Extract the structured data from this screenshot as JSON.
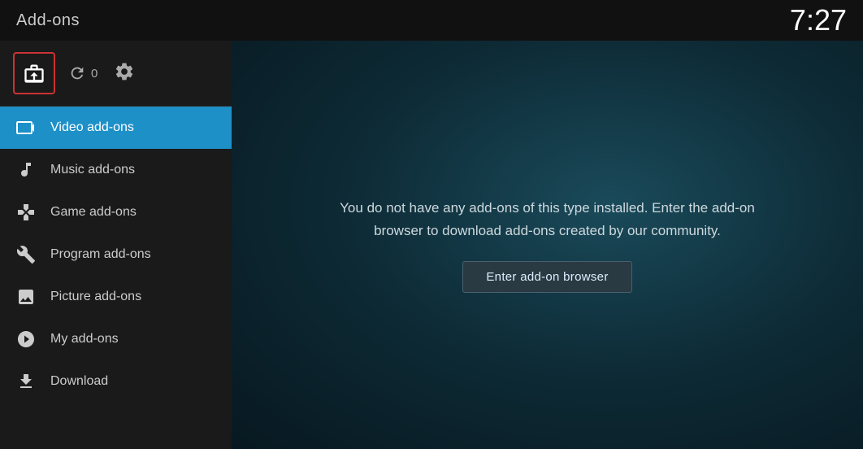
{
  "topbar": {
    "title": "Add-ons",
    "time": "7:27"
  },
  "toolbar": {
    "refresh_count": "0",
    "box_icon": "addon-box-icon",
    "refresh_icon": "refresh-icon",
    "settings_icon": "settings-gear-icon"
  },
  "sidebar": {
    "items": [
      {
        "id": "video",
        "label": "Video add-ons",
        "icon": "video-icon",
        "active": true
      },
      {
        "id": "music",
        "label": "Music add-ons",
        "icon": "music-icon",
        "active": false
      },
      {
        "id": "game",
        "label": "Game add-ons",
        "icon": "game-icon",
        "active": false
      },
      {
        "id": "program",
        "label": "Program add-ons",
        "icon": "program-icon",
        "active": false
      },
      {
        "id": "picture",
        "label": "Picture add-ons",
        "icon": "picture-icon",
        "active": false
      },
      {
        "id": "myaddon",
        "label": "My add-ons",
        "icon": "myaddon-icon",
        "active": false
      },
      {
        "id": "download",
        "label": "Download",
        "icon": "download-icon",
        "active": false
      }
    ]
  },
  "content": {
    "message": "You do not have any add-ons of this type installed. Enter the add-on browser to download add-ons created by our community.",
    "browser_button": "Enter add-on browser"
  }
}
